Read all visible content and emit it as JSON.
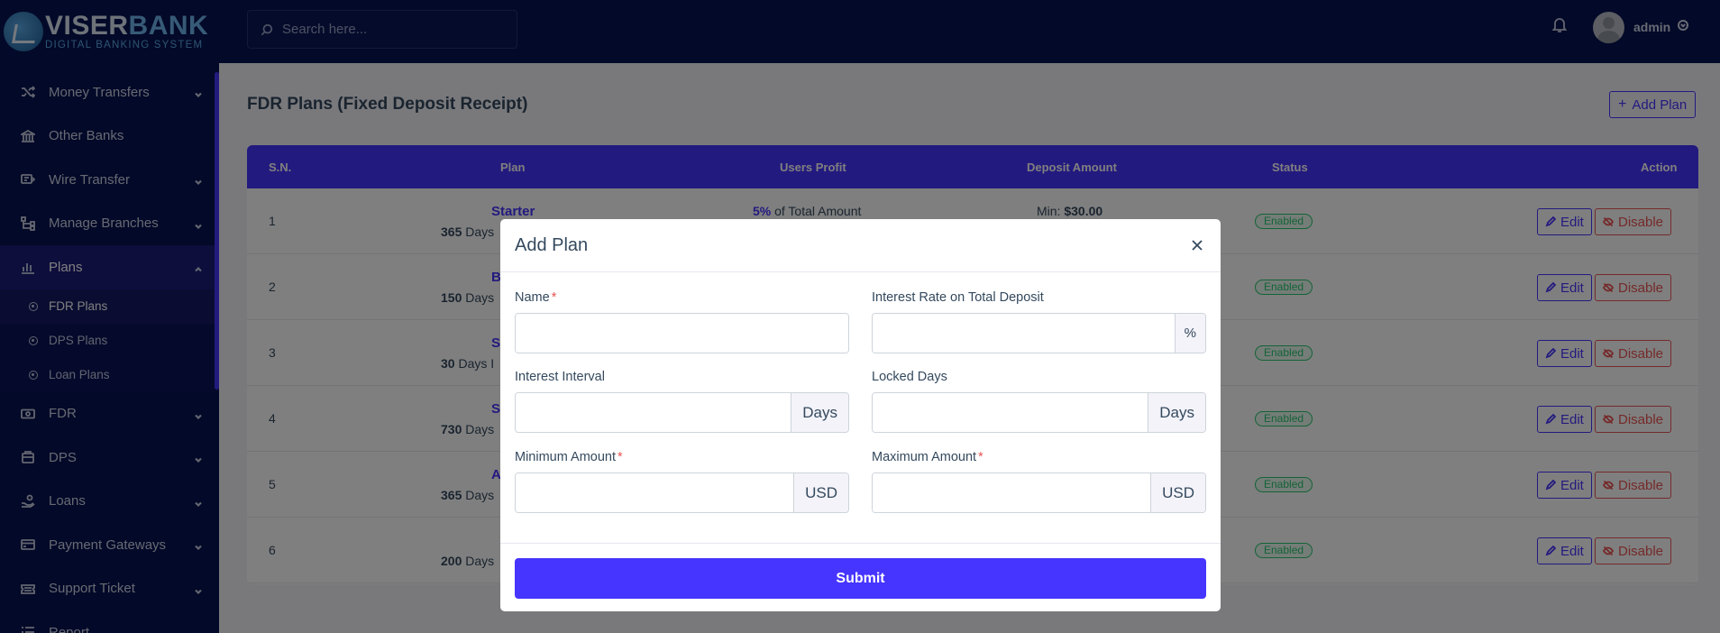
{
  "brand": {
    "name_part1": "VISER",
    "name_part2": "BANK",
    "tagline": "DIGITAL BANKING SYSTEM"
  },
  "sidebar": {
    "items": [
      {
        "label": "Money Transfers",
        "icon": "shuffle-icon",
        "has_children": true
      },
      {
        "label": "Other Banks",
        "icon": "bank-icon",
        "has_children": false
      },
      {
        "label": "Wire Transfer",
        "icon": "wire-transfer-icon",
        "has_children": true
      },
      {
        "label": "Manage Branches",
        "icon": "branches-icon",
        "has_children": true
      },
      {
        "label": "Plans",
        "icon": "chart-icon",
        "has_children": true,
        "active": true,
        "children": [
          {
            "label": "FDR Plans",
            "active": true
          },
          {
            "label": "DPS Plans"
          },
          {
            "label": "Loan Plans"
          }
        ]
      },
      {
        "label": "FDR",
        "icon": "money-icon",
        "has_children": true
      },
      {
        "label": "DPS",
        "icon": "wallet-icon",
        "has_children": true
      },
      {
        "label": "Loans",
        "icon": "hand-coin-icon",
        "has_children": true
      },
      {
        "label": "Payment Gateways",
        "icon": "credit-card-icon",
        "has_children": true
      },
      {
        "label": "Support Ticket",
        "icon": "ticket-icon",
        "has_children": true
      },
      {
        "label": "Report",
        "icon": "list-icon",
        "has_children": true
      }
    ]
  },
  "topbar": {
    "search_placeholder": "Search here...",
    "username": "admin"
  },
  "page": {
    "title": "FDR Plans (Fixed Deposit Receipt)",
    "add_button": "Add Plan"
  },
  "table": {
    "headers": [
      "S.N.",
      "Plan",
      "Users Profit",
      "Deposit Amount",
      "Status",
      "Action"
    ],
    "rows": [
      {
        "sn": "1",
        "plan": "Starter",
        "days": "365",
        "days_suffix": " Days",
        "profit_rate": "5%",
        "profit_suffix": " of Total Amount",
        "deposit_prefix": "Min: ",
        "deposit_min": "$30.00",
        "status": "Enabled"
      },
      {
        "sn": "2",
        "plan": "B",
        "days": "150",
        "days_suffix": " Days",
        "profit_rate": "",
        "profit_suffix": "",
        "deposit_prefix": "",
        "deposit_min": "",
        "status": "Enabled"
      },
      {
        "sn": "3",
        "plan": "Sta",
        "days": "30",
        "days_suffix": " Days I",
        "profit_rate": "",
        "profit_suffix": "",
        "deposit_prefix": "",
        "deposit_min": "",
        "status": "Enabled"
      },
      {
        "sn": "4",
        "plan": "Stand",
        "days": "730",
        "days_suffix": " Days",
        "profit_rate": "",
        "profit_suffix": "",
        "deposit_prefix": "",
        "deposit_min": "",
        "status": "Enabled"
      },
      {
        "sn": "5",
        "plan": "Ad",
        "days": "365",
        "days_suffix": " Days",
        "profit_rate": "",
        "profit_suffix": "",
        "deposit_prefix": "",
        "deposit_min": "",
        "status": "Enabled"
      },
      {
        "sn": "6",
        "plan": "",
        "days": "200",
        "days_suffix": " Days",
        "profit_rate": "",
        "profit_suffix": "",
        "deposit_prefix": "",
        "deposit_min": "",
        "status": "Enabled"
      }
    ],
    "edit_label": "Edit",
    "disable_label": "Disable"
  },
  "modal": {
    "title": "Add Plan",
    "fields": {
      "name": {
        "label": "Name",
        "required": true,
        "value": ""
      },
      "interest_rate": {
        "label": "Interest Rate on Total Deposit",
        "addon": "%",
        "value": ""
      },
      "interest_interval": {
        "label": "Interest Interval",
        "addon": "Days",
        "value": ""
      },
      "locked_days": {
        "label": "Locked Days",
        "addon": "Days",
        "value": ""
      },
      "minimum_amount": {
        "label": "Minimum Amount",
        "required": true,
        "addon": "USD",
        "value": ""
      },
      "maximum_amount": {
        "label": "Maximum Amount",
        "required": true,
        "addon": "USD",
        "value": ""
      }
    },
    "required_mark": "*",
    "submit_label": "Submit"
  },
  "colors": {
    "sidebar_bg": "#071251",
    "accent": "#4634ff",
    "success": "#28c76f",
    "danger": "#ea5455"
  }
}
